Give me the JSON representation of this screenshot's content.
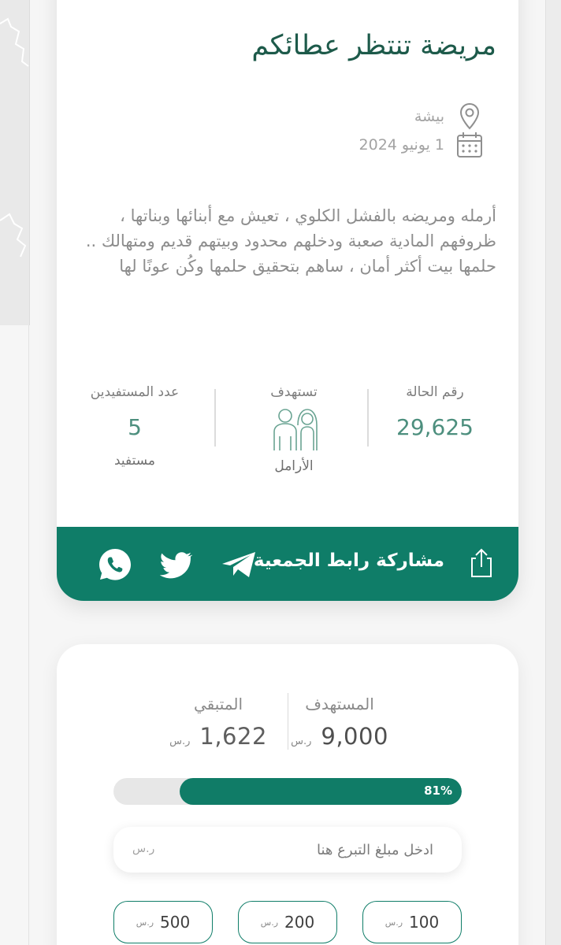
{
  "case": {
    "title": "مريضة تنتظر عطائكم",
    "location": "بيشة",
    "date": "1 يونيو 2024",
    "description": "أرمله ومريضه بالفشل الكلوي ، تعيش مع أبنائها وبناتها ، ظروفهم المادية صعبة ودخلهم محدود وبيتهم قديم ومتهالك .. حلمها بيت أكثر أمان ، ساهم بتحقيق حلمها وكُن عونًا لها"
  },
  "stats": {
    "case_number_label": "رقم الحالة",
    "case_number": "29,625",
    "target_label": "تستهدف",
    "target_group": "الأرامل",
    "beneficiaries_label": "عدد المستفيدين",
    "beneficiaries_count": "5",
    "beneficiaries_unit": "مستفيد"
  },
  "share": {
    "label": "مشاركة رابط الجمعية",
    "icons": [
      "share-icon",
      "telegram-icon",
      "twitter-icon",
      "whatsapp-icon"
    ]
  },
  "donation": {
    "target_label": "المستهدف",
    "target_value": "9,000",
    "remaining_label": "المتبقي",
    "remaining_value": "1,622",
    "currency": "ر.س",
    "progress_percent": 81,
    "progress_text": "81%",
    "input_placeholder": "ادخل مبلغ التبرع هنا",
    "quick_amounts": [
      "100",
      "200",
      "500"
    ]
  },
  "colors": {
    "brand_green": "#0f7d68",
    "title_green": "#1d5a4a",
    "value_green": "#4d8f7e"
  }
}
